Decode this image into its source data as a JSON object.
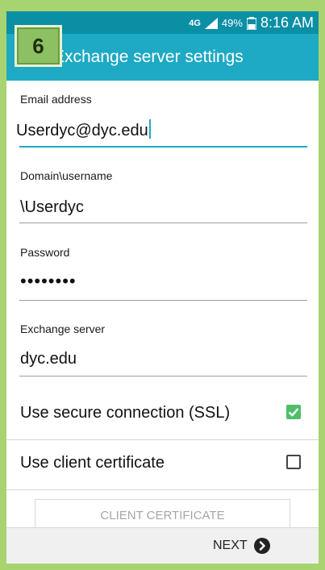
{
  "status": {
    "network": "4G",
    "battery": "49%",
    "time": "8:16 AM"
  },
  "step_badge": "6",
  "appbar": {
    "title": "Exchange server settings"
  },
  "fields": {
    "email": {
      "label": "Email address",
      "value": "Userdyc@dyc.edu"
    },
    "domain": {
      "label": "Domain\\username",
      "value": "\\Userdyc"
    },
    "password": {
      "label": "Password",
      "value": "••••••••"
    },
    "server": {
      "label": "Exchange server",
      "value": "dyc.edu"
    }
  },
  "options": {
    "ssl": {
      "label": "Use secure connection (SSL)",
      "checked": true
    },
    "client_cert": {
      "label": "Use client certificate",
      "checked": false
    }
  },
  "buttons": {
    "client_certificate": "CLIENT CERTIFICATE",
    "next": "NEXT"
  },
  "colors": {
    "status_bar": "#0b8fa5",
    "app_bar": "#1ea9c4",
    "frame": "#a7d470",
    "checkbox_on": "#4dbf6a"
  }
}
